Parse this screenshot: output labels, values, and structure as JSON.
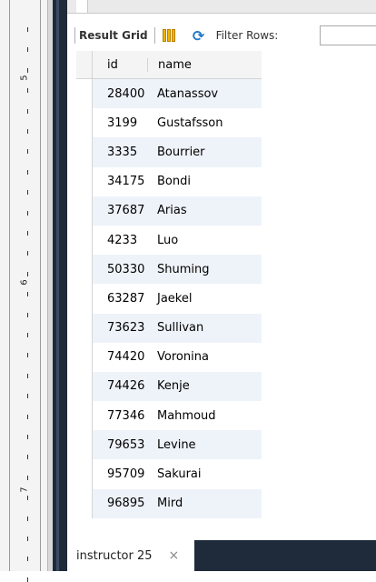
{
  "ruler": {
    "labels": [
      "5",
      "6",
      "7"
    ]
  },
  "toolbar": {
    "title": "Result Grid",
    "filter_label": "Filter Rows:",
    "filter_value": ""
  },
  "table": {
    "columns": [
      "id",
      "name"
    ],
    "rows": [
      {
        "id": "28400",
        "name": "Atanassov"
      },
      {
        "id": "3199",
        "name": "Gustafsson"
      },
      {
        "id": "3335",
        "name": "Bourrier"
      },
      {
        "id": "34175",
        "name": "Bondi"
      },
      {
        "id": "37687",
        "name": "Arias"
      },
      {
        "id": "4233",
        "name": "Luo"
      },
      {
        "id": "50330",
        "name": "Shuming"
      },
      {
        "id": "63287",
        "name": "Jaekel"
      },
      {
        "id": "73623",
        "name": "Sullivan"
      },
      {
        "id": "74420",
        "name": "Voronina"
      },
      {
        "id": "74426",
        "name": "Kenje"
      },
      {
        "id": "77346",
        "name": "Mahmoud"
      },
      {
        "id": "79653",
        "name": "Levine"
      },
      {
        "id": "95709",
        "name": "Sakurai"
      },
      {
        "id": "96895",
        "name": "Mird"
      }
    ]
  },
  "tabs": [
    {
      "label": "instructor 25",
      "close": "×"
    }
  ],
  "colors": {
    "alt_row": "#eef3fa",
    "dark_band": "#1f2a3a",
    "grid_icon": "#f1b400",
    "refresh_icon": "#1e78c8"
  },
  "icons": [
    "grid-icon",
    "refresh-icon",
    "close-icon"
  ]
}
